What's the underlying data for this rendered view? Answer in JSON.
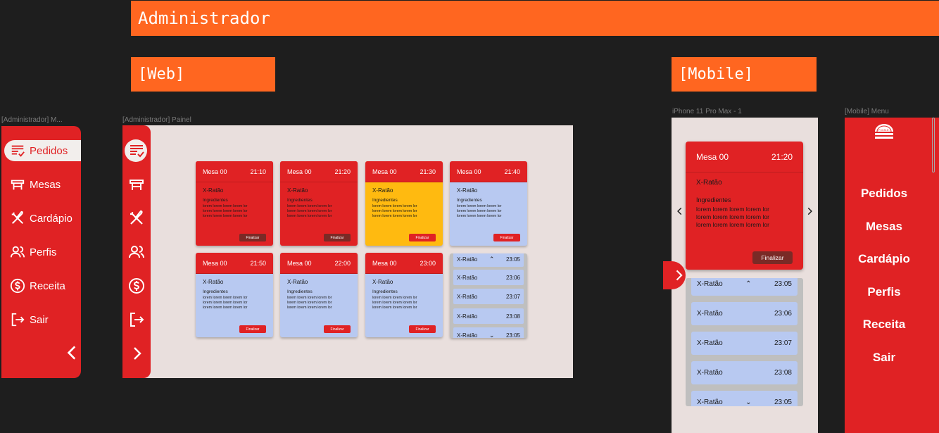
{
  "banners": {
    "admin": "Administrador",
    "web": "[Web]",
    "mobile": "[Mobile]"
  },
  "frame_labels": {
    "menu": "[Administrador] M...",
    "panel": "[Administrador] Painel",
    "phone": "iPhone 11 Pro Max - 1",
    "mobile_menu": "[Mobile] Menu"
  },
  "sidebar": {
    "items": [
      {
        "label": "Pedidos",
        "icon": "orders-list-icon"
      },
      {
        "label": "Mesas",
        "icon": "table-icon"
      },
      {
        "label": "Cardápio",
        "icon": "utensils-icon"
      },
      {
        "label": "Perfis",
        "icon": "users-icon"
      },
      {
        "label": "Receita",
        "icon": "dollar-icon"
      },
      {
        "label": "Sair",
        "icon": "logout-icon"
      }
    ]
  },
  "orders": [
    {
      "mesa": "Mesa 00",
      "time": "21:10",
      "title": "X-Ratão",
      "ingredients": "Ingredientes",
      "button": "Finalizar",
      "status": "red"
    },
    {
      "mesa": "Mesa 00",
      "time": "21:20",
      "title": "X-Ratão",
      "ingredients": "Ingredientes",
      "button": "Finalizar",
      "status": "red"
    },
    {
      "mesa": "Mesa 00",
      "time": "21:30",
      "title": "X-Ratão",
      "ingredients": "Ingredientes",
      "button": "Finalizar",
      "status": "yellow"
    },
    {
      "mesa": "Mesa 00",
      "time": "21:40",
      "title": "X-Ratão",
      "ingredients": "Ingredientes",
      "button": "Finalizar",
      "status": "blue"
    },
    {
      "mesa": "Mesa 00",
      "time": "21:50",
      "title": "X-Ratão",
      "ingredients": "Ingredientes",
      "button": "Finalizar",
      "status": "blue"
    },
    {
      "mesa": "Mesa 00",
      "time": "22:00",
      "title": "X-Ratão",
      "ingredients": "Ingredientes",
      "button": "Finalizar",
      "status": "blue"
    },
    {
      "mesa": "Mesa 00",
      "time": "23:00",
      "title": "X-Ratão",
      "ingredients": "Ingredientes",
      "button": "Finalizar",
      "status": "blue"
    }
  ],
  "lorem_line": "lorem lorem lorem lorem lor",
  "queue": [
    {
      "name": "X-Ratão",
      "time": "23:05"
    },
    {
      "name": "X-Ratão",
      "time": "23:06"
    },
    {
      "name": "X-Ratão",
      "time": "23:07"
    },
    {
      "name": "X-Ratão",
      "time": "23:08"
    },
    {
      "name": "X-Ratão",
      "time": "23:05"
    }
  ],
  "mobile_order": {
    "mesa": "Mesa 00",
    "time": "21:20",
    "title": "X-Ratão",
    "ingredients": "Ingredientes",
    "button": "Finalizar"
  },
  "mobile_menu": {
    "logo": "F.O.M.E.",
    "items": [
      "Pedidos",
      "Mesas",
      "Cardápio",
      "Perfis",
      "Receita",
      "Sair"
    ]
  },
  "colors": {
    "brand_red": "#e02224",
    "orange": "#ff6620",
    "yellow": "#ffba10",
    "blue": "#b8c9f1",
    "bg": "#e9dfdd"
  }
}
